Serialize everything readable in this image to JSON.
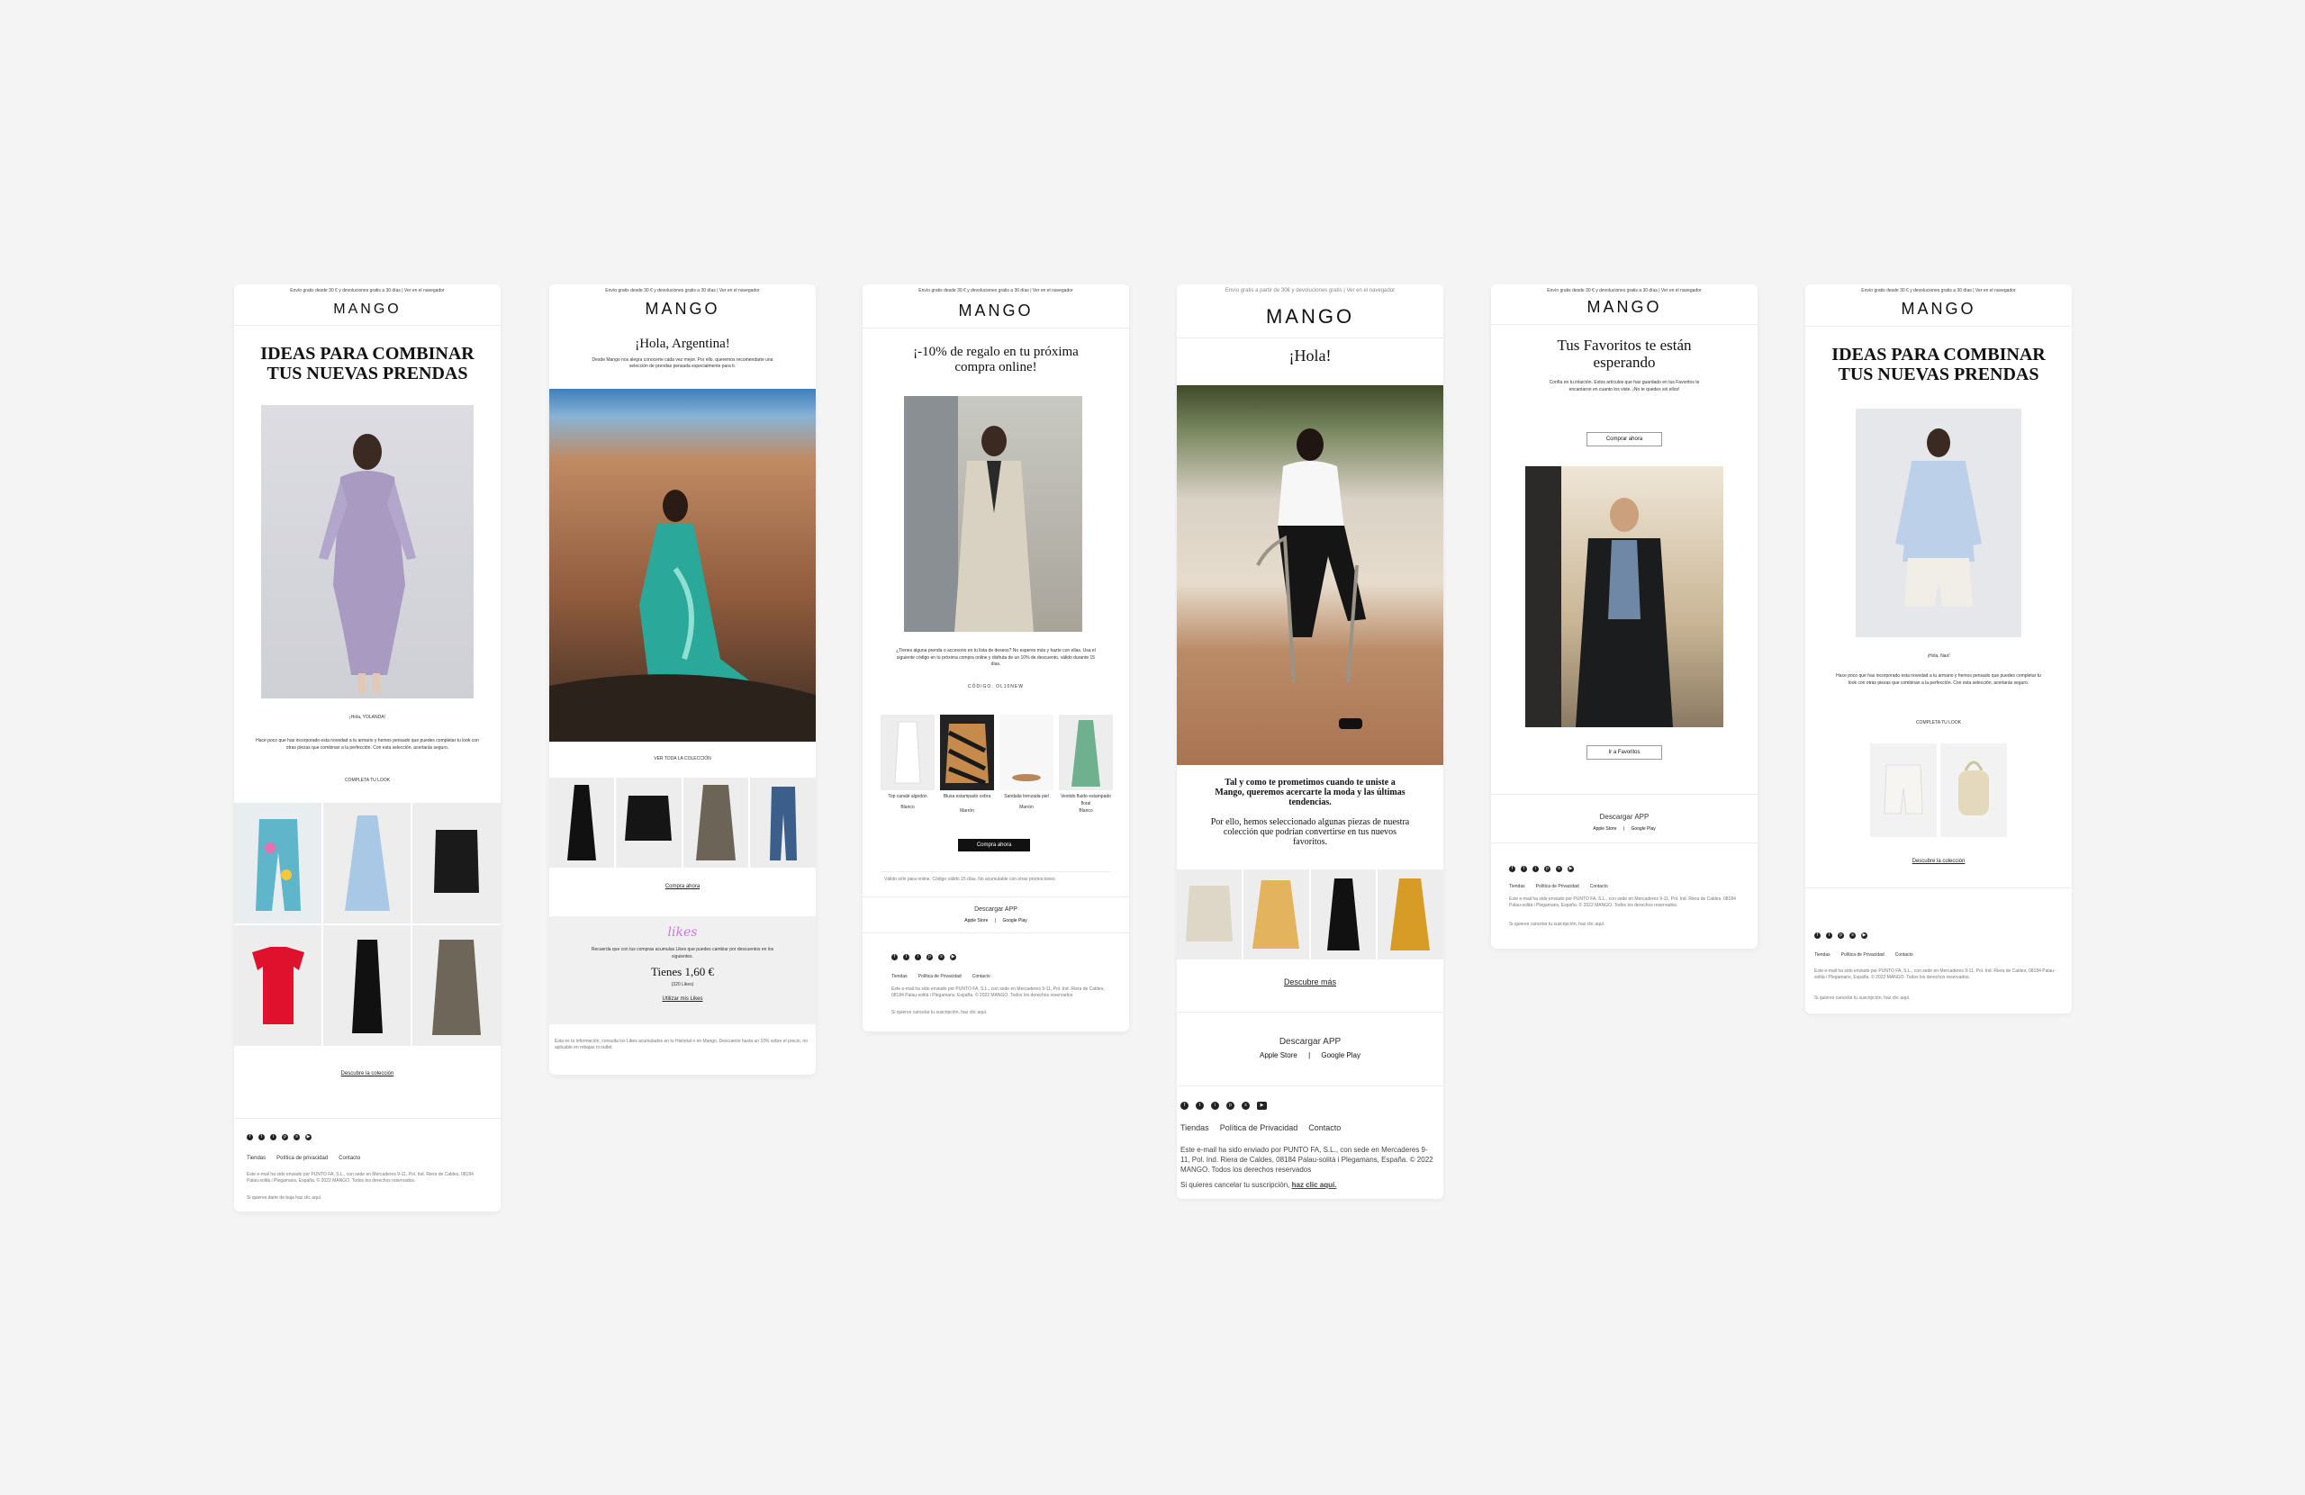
{
  "emails": [
    {
      "topbar": "Envío gratis desde 30 € y devoluciones gratis a 30 días | Ver en el navegador",
      "logo": "MANGO",
      "headline_line1": "IDEAS PARA COMBINAR",
      "headline_line2": "TUS NUEVAS PRENDAS",
      "greeting": "¡Hola, YOLANDA!",
      "body": "Hace poco que has incorporado esta novedad a tu armario y hemos pensado que puedes completar tu look con otras piezas que combinan a la perfección. Con esta selección, acertarás seguro.",
      "cta": "COMPLETA TU LOOK",
      "link": "Descubre la colección",
      "footer_links": [
        "Tiendas",
        "Política de privacidad",
        "Contacto"
      ],
      "legal": "Este e-mail ha sido enviado por PUNTO FA, S.L., con sede en Mercaderes 9-11, Pol. Ind. Riera de Caldes, 08184 Palau-solità i Plegamans, España. © 2022 MANGO. Todos los derechos reservados.",
      "unsubscribe": "Si quieres darte de baja haz clic aquí."
    },
    {
      "topbar": "Envío gratis desde 30 € y devoluciones gratis a 30 días | Ver en el navegador",
      "logo": "MANGO",
      "headline": "¡Hola, Argentina!",
      "intro": "Desde Mango nos alegra conocerte cada vez mejor. Por ello, queremos recomendarte una selección de prendas pensada especialmente para ti.",
      "sub": "VER TODA LA COLECCIÓN",
      "link": "Compra ahora",
      "likes_logo": "likes",
      "likes_text": "Recuerda que con tus compras acumulas Likes que puedes cambiar por descuentos en los siguientes.",
      "balance": "Tienes 1,60 €",
      "likes_points": "(320 Likes)",
      "likes_link": "Utilizar mis Likes",
      "legal": "Esta es tu información, consulta los Likes acumulados en tu Historial o en Mango. Descuento hasta un 10% sobre el precio, no aplicable en rebajas ni outlet."
    },
    {
      "topbar": "Envío gratis desde 30 € y devoluciones gratis a 30 días | Ver en el navegador",
      "logo": "MANGO",
      "headline_line1": "¡-10% de regalo en tu próxima",
      "headline_line2": "compra online!",
      "body": "¿Tienes alguna prenda o accesorio en tu lista de deseos? No esperes más y hazte con ellas. Usa el siguiente código en tu próxima compra online y disfruta de un 10% de descuento, válido durante 15 días.",
      "code": "CÓDIGO: OL10NEW",
      "products": [
        {
          "name": "Top canalé algodón",
          "price": "Blanco"
        },
        {
          "name": "Blusa estampado cebra",
          "price": "Marrón"
        },
        {
          "name": "Sandalia trenzada piel",
          "price": "Marrón"
        },
        {
          "name": "Vestido fluido estampado floral",
          "price": "Blanco"
        }
      ],
      "button": "Compra ahora",
      "disclaimer": "Válido sólo para online. Código válido 15 días. No acumulable con otras promociones.",
      "app_title": "Descargar APP",
      "app_links": [
        "Apple Store",
        "Google Play"
      ],
      "footer_links": [
        "Tiendas",
        "Política de Privacidad",
        "Contacto"
      ],
      "legal": "Este e-mail ha sido enviado por PUNTO FA, S.L., con sede en Mercaderes 9-11, Pol. Ind. Riera de Caldes, 08184 Palau-solità i Plegamans, España. © 2022 MANGO. Todos los derechos reservados.",
      "unsubscribe": "Si quieres cancelar tu suscripción, haz clic aquí."
    },
    {
      "topbar": "Envío gratis a partir de 30€ y devoluciones gratis | Ver en el navegador",
      "logo": "MANGO",
      "headline": "¡Hola!",
      "lead": "Tal y como te prometimos cuando te uniste a Mango, queremos acercarte la moda y las últimas tendencias.",
      "lead2": "Por ello, hemos seleccionado algunas piezas de nuestra colección que podrían convertirse en tus nuevos favoritos.",
      "link": "Descubre más",
      "app_title": "Descargar APP",
      "app_store": "Apple Store",
      "separator": "|",
      "google_play": "Google Play",
      "footer_links": [
        "Tiendas",
        "Política de Privacidad",
        "Contacto"
      ],
      "legal": "Este e-mail ha sido enviado por PUNTO FA, S.L., con sede en Mercaderes 9-11, Pol. Ind. Riera de Caldes, 08184 Palau-solità i Plegamans, España. © 2022 MANGO. Todos los derechos reservados",
      "unsubscribe_prefix": "Si quieres cancelar tu suscripción,",
      "unsubscribe_link": "haz clic aquí."
    },
    {
      "topbar": "Envío gratis desde 30 € y devoluciones gratis a 30 días | Ver en el navegador",
      "logo": "MANGO",
      "headline_line1": "Tus Favoritos te están",
      "headline_line2": "esperando",
      "body": "Confía en tu intuición. Estos artículos que has guardado en tus Favoritos te encantaron en cuanto los viste. ¡No te quedes sin ellos!",
      "button": "Comprar ahora",
      "button2": "Ir a Favoritos",
      "app_title": "Descargar APP",
      "app_links": [
        "Apple Store",
        "Google Play"
      ],
      "footer_links": [
        "Tiendas",
        "Política de Privacidad",
        "Contacto"
      ],
      "legal": "Este e-mail ha sido enviado por PUNTO FA, S.L., con sede en Mercaderes 9-11, Pol. Ind. Riera de Caldes, 08184 Palau-solità i Plegamans, España. © 2022 MANGO. Todos los derechos reservados.",
      "unsubscribe": "Si quieres cancelar tu suscripción, haz clic aquí."
    },
    {
      "topbar": "Envío gratis desde 30 € y devoluciones gratis a 30 días | Ver en el navegador",
      "logo": "MANGO",
      "headline_line1": "IDEAS PARA COMBINAR",
      "headline_line2": "TUS NUEVAS PRENDAS",
      "greeting": "¡Hola, Nao!",
      "body": "Hace poco que has incorporado esta novedad a tu armario y hemos pensado que puedes completar tu look con otras piezas que combinan a la perfección. Con esta selección, acertarás seguro.",
      "cta": "COMPLETA TU LOOK",
      "link": "Descubre la colección",
      "footer_links": [
        "Tiendas",
        "Política de Privacidad",
        "Contacto"
      ],
      "legal": "Este e-mail ha sido enviado por PUNTO FA, S.L., con sede en Mercaderes 9-11, Pol. Ind. Riera de Caldes, 08184 Palau-solità i Plegamans, España. © 2022 MANGO. Todos los derechos reservados.",
      "unsubscribe": "Si quieres cancelar tu suscripción, haz clic aquí."
    }
  ],
  "colors": {
    "background": "#f4f4f4",
    "card": "#ffffff",
    "brand_black": "#111111"
  }
}
